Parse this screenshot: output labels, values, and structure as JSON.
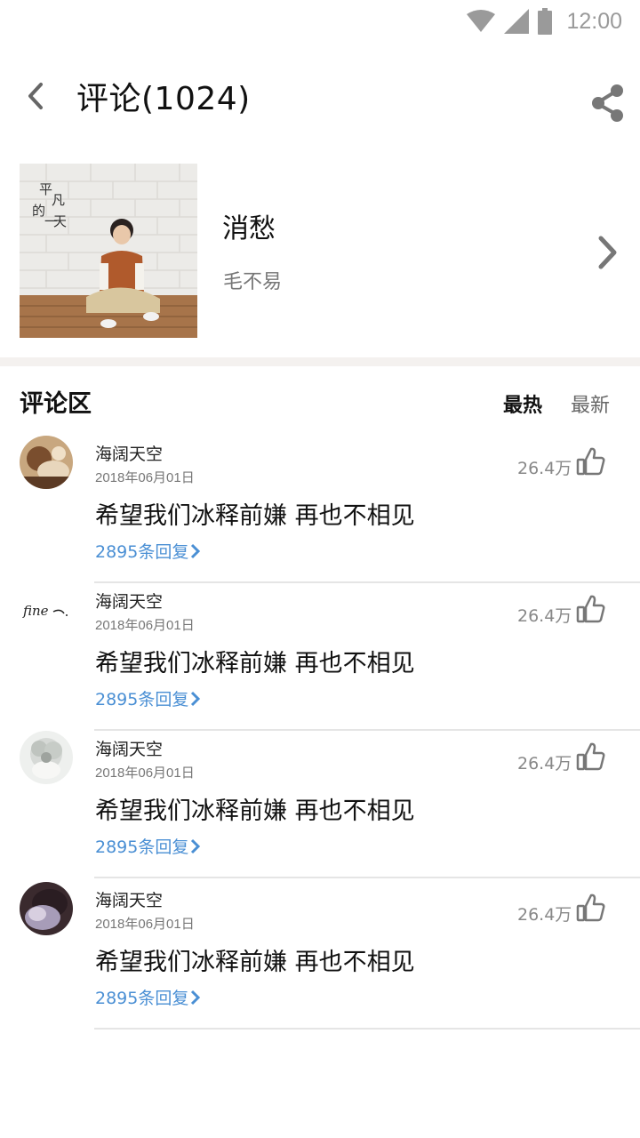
{
  "status_bar": {
    "time": "12:00",
    "icons": [
      "wifi-icon",
      "cellular-signal-icon",
      "battery-icon"
    ]
  },
  "header": {
    "title": "评论(1024)",
    "back_icon": "chevron-left-icon",
    "share_icon": "share-icon"
  },
  "song": {
    "cover_text": "平凡的一天",
    "title": "消愁",
    "artist": "毛不易",
    "arrow_icon": "chevron-right-icon"
  },
  "comments_section": {
    "title": "评论区",
    "sort_hot": "最热",
    "sort_new": "最新"
  },
  "comments": [
    {
      "user": "海阔天空",
      "date": "2018年06月01日",
      "text": "希望我们冰释前嫌 再也不相见",
      "replies": "2895条回复",
      "likes": "26.4万"
    },
    {
      "user": "海阔天空",
      "date": "2018年06月01日",
      "text": "希望我们冰释前嫌 再也不相见",
      "replies": "2895条回复",
      "likes": "26.4万",
      "avatar_text": "fine"
    },
    {
      "user": "海阔天空",
      "date": "2018年06月01日",
      "text": "希望我们冰释前嫌 再也不相见",
      "replies": "2895条回复",
      "likes": "26.4万"
    },
    {
      "user": "海阔天空",
      "date": "2018年06月01日",
      "text": "希望我们冰释前嫌 再也不相见",
      "replies": "2895条回复",
      "likes": "26.4万"
    }
  ],
  "colors": {
    "link_blue": "#4a8fd4",
    "divider": "#e5e5e5",
    "section_divider": "#f4f1ef",
    "icon_gray": "#9a9a9a"
  }
}
